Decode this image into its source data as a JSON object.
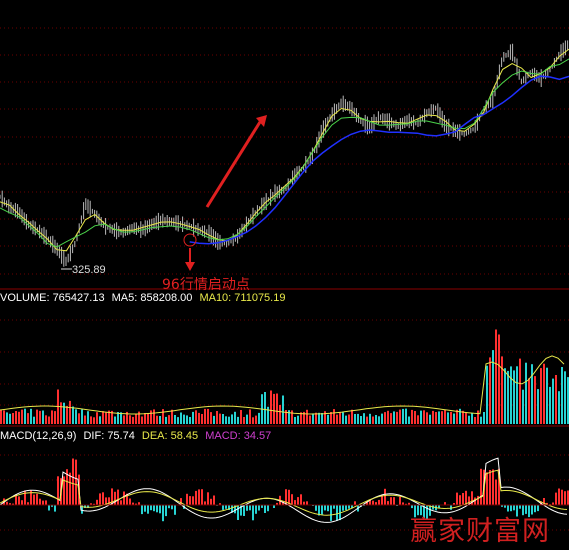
{
  "colors": {
    "background": "#000000",
    "grid": "#6b0000",
    "panel_divider": "#8b0000",
    "price": "#dcdcdc",
    "ma_yellow": "#e8e84a",
    "ma_green": "#4ad24a",
    "ma_blue": "#2030ff",
    "up": "#ff3030",
    "down": "#27d3d3",
    "volume_label": "#ffffff",
    "ma10_label": "#e8e84a",
    "macd_label": "#d040d0",
    "dea_label": "#e8e84a",
    "annotation": "#e02020",
    "watermark": "#d02020"
  },
  "price_panel": {
    "low_marker": "325.89",
    "annotation": "96行情启动点"
  },
  "volume_panel": {
    "volume_label": "VOLUME: 765427.13",
    "ma5_label": "MA5: 858208.00",
    "ma10_label": "MA10: 711075.19"
  },
  "macd_panel": {
    "name_label": "MACD(12,26,9)",
    "dif_label": "DIF: 75.74",
    "dea_label": "DEA: 58.45",
    "macd_label": "MACD: 34.57"
  },
  "watermark": "赢家财富网",
  "chart_data": [
    {
      "type": "line",
      "title": "",
      "series": [
        {
          "name": "",
          "values": [
            420,
            405,
            398,
            380,
            372,
            360,
            345,
            326,
            355,
            410,
            395,
            378,
            372,
            368,
            375,
            372,
            380,
            386,
            384,
            381,
            378,
            372,
            368,
            355,
            352,
            362,
            380,
            398,
            412,
            425,
            430,
            450,
            462,
            480,
            515,
            538,
            555,
            548,
            530,
            520,
            535,
            528,
            522,
            530,
            525,
            540,
            548,
            522,
            515,
            510,
            518,
            545,
            560,
            620,
            630,
            585,
            600,
            590,
            602,
            625,
            640
          ]
        }
      ],
      "low_value": 325.89
    },
    {
      "type": "bar",
      "title": "",
      "series": [
        {
          "name": "VOLUME",
          "last": 765427.13
        },
        {
          "name": "MA5",
          "last": 858208.0
        },
        {
          "name": "MA10",
          "last": 711075.19
        }
      ]
    },
    {
      "type": "bar",
      "title": "",
      "series": [
        {
          "name": "DIF",
          "last": 75.74
        },
        {
          "name": "DEA",
          "last": 58.45
        },
        {
          "name": "MACD",
          "last": 34.57
        }
      ],
      "params": "12,26,9"
    }
  ]
}
